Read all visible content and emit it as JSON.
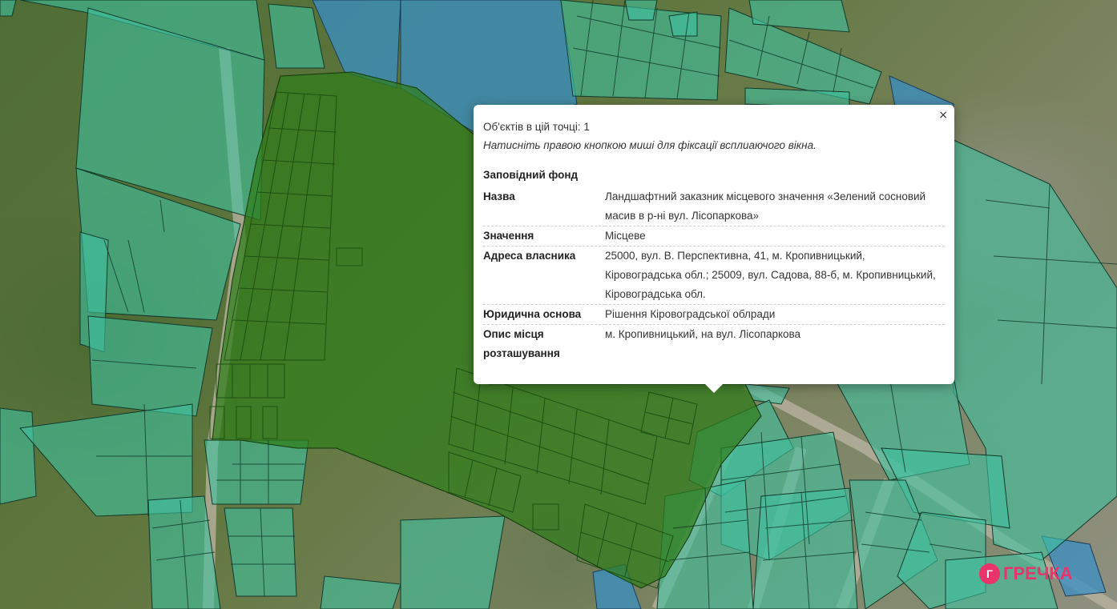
{
  "popup": {
    "close_label": "×",
    "objects_count": "Об'єктів в цій точці: 1",
    "hint": "Натисніть правою кнопкою миші для фіксації всплиаючого вікна.",
    "section": "Заповідний фонд",
    "rows": [
      {
        "key": "Назва",
        "value": "Ландшафтний заказник місцевого значення «Зелений сосновий масив в р-ні вул. Лісопаркова»"
      },
      {
        "key": "Значення",
        "value": "Місцеве"
      },
      {
        "key": "Адреса власника",
        "value": "25000, вул. В. Перспективна, 41, м. Кропивницький, Кіровоградська обл.; 25009, вул. Садова, 88-б, м. Кропивницький, Кіровоградська обл."
      },
      {
        "key": "Юридична основа",
        "value": "Рішення Кіровоградської облради"
      },
      {
        "key": "Опис місця розташування",
        "value": "м. Кропивницький, на вул. Лісопаркова"
      }
    ]
  },
  "logo": {
    "text": "ГРЕЧКА",
    "mark": "Г"
  },
  "colors": {
    "reserve_fill": "#2f7d1a",
    "parcel_fill": "#3fc2a0",
    "water_fill": "#3a8fc4",
    "logo": "#e8346a"
  }
}
